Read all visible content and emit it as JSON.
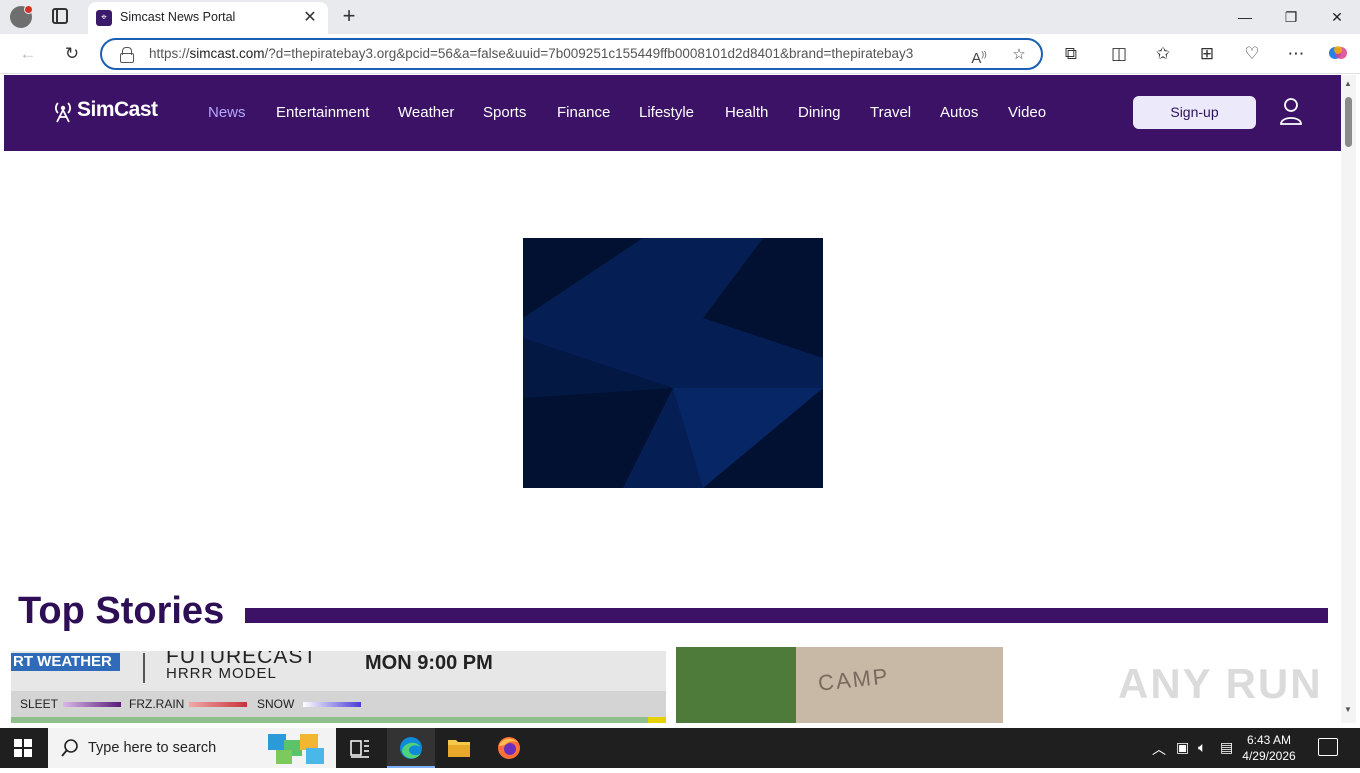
{
  "browser": {
    "tab_title": "Simcast News Portal",
    "tab_close": "✕",
    "new_tab": "+",
    "url_prefix": "https://",
    "url_host": "simcast.com",
    "url_rest": "/?d=thepiratebay3.org&pcid=56&a=false&uuid=7b009251c155449ffb0008101d2d8401&brand=thepiratebay3",
    "window": {
      "minimize": "—",
      "restore": "❐",
      "close": "✕"
    }
  },
  "site": {
    "logo_text": "SimCast",
    "nav": [
      "News",
      "Entertainment",
      "Weather",
      "Sports",
      "Finance",
      "Lifestyle",
      "Health",
      "Dining",
      "Travel",
      "Autos",
      "Video"
    ],
    "active_nav": "News",
    "signup_label": "Sign-up",
    "colors": {
      "header": "#3b1266",
      "accent": "#b7a7ff",
      "title": "#2e0f56"
    }
  },
  "content": {
    "section_title": "Top Stories",
    "story1": {
      "badge": "RT WEATHER",
      "title": "FUTURECAST",
      "subtitle": "HRRR MODEL",
      "time": "MON 9:00 PM",
      "legend": [
        "SLEET",
        "FRZ.RAIN",
        "SNOW"
      ]
    },
    "story2": {
      "sign_text": "CAMP"
    },
    "watermark": "ANY RUN"
  },
  "taskbar": {
    "search_placeholder": "Type here to search",
    "time": "6:43 AM",
    "date": "4/29/2026"
  }
}
